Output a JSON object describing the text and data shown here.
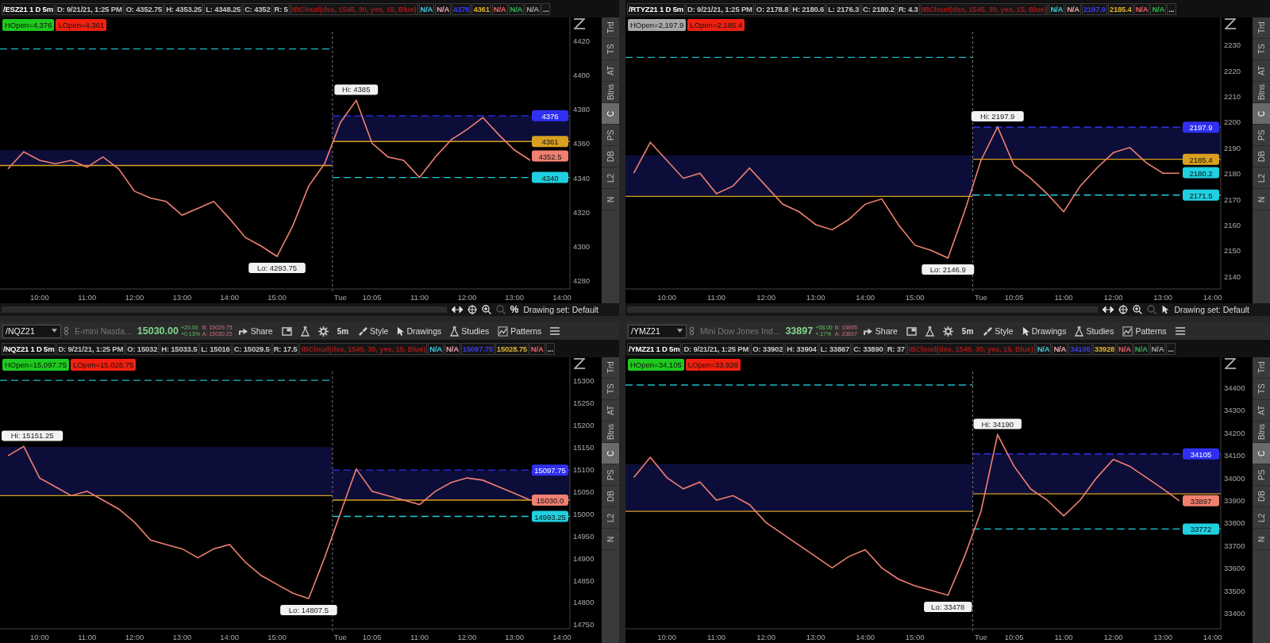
{
  "panels": [
    {
      "header": [
        {
          "text": "/ESZ21 1 D 5m",
          "color": "#ffffff"
        },
        {
          "text": "D: 9/21/21, 1:25 PM",
          "color": "#c8c8c8"
        },
        {
          "text": "O: 4352.75",
          "color": "#c8c8c8"
        },
        {
          "text": "H: 4353.25",
          "color": "#c8c8c8"
        },
        {
          "text": "L: 4348.25",
          "color": "#c8c8c8"
        },
        {
          "text": "C: 4352",
          "color": "#c8c8c8"
        },
        {
          "text": "R: 5",
          "color": "#c8c8c8"
        },
        {
          "text": "IBCloud(dss, 1545, 30, yes, 15, Blue)",
          "color": "#a01818"
        },
        {
          "text": "N/A",
          "color": "#3ec8e0"
        },
        {
          "text": "N/A",
          "color": "#f0a0b0"
        },
        {
          "text": "4376",
          "color": "#3a3af0"
        },
        {
          "text": "4361",
          "color": "#e0b030"
        },
        {
          "text": "N/A",
          "color": "#f06060"
        },
        {
          "text": "N/A",
          "color": "#30b050"
        },
        {
          "text": "N/A",
          "color": "#a0a0a0"
        },
        {
          "text": "..."
        }
      ],
      "badges": [
        {
          "text": "HOpen=4,376",
          "color": "#1ec81e"
        },
        {
          "text": "LOpen=4,361",
          "color": "#f02010"
        }
      ],
      "chart_data": {
        "type": "line",
        "categories": [
          null,
          null,
          "10:00",
          null,
          null,
          "11:00",
          null,
          null,
          "12:00",
          null,
          null,
          "13:00",
          null,
          null,
          "14:00",
          null,
          null,
          "15:00",
          null,
          null,
          null,
          "Tue",
          null,
          "10:05",
          null,
          null,
          "11:00",
          null,
          null,
          "12:00",
          null,
          null,
          "13:00",
          null,
          null,
          "14:00"
        ],
        "series": [
          {
            "color": "#f08070",
            "values": [
              4345,
              4355,
              4350,
              4348,
              4350,
              4346,
              4352,
              4345,
              4332,
              4328,
              4326,
              4318,
              4322,
              4326,
              4316,
              4305,
              4300,
              4294,
              4312,
              4335,
              4348,
              4372,
              4385,
              4360,
              4352,
              4350,
              4340,
              4352,
              4362,
              4368,
              4375,
              4365,
              4356,
              4350,
              null,
              null
            ]
          }
        ],
        "ylim": [
          4275,
          4425
        ],
        "yticks": [
          4280,
          4300,
          4320,
          4340,
          4360,
          4380,
          4400,
          4420
        ],
        "annotations": [
          {
            "y": 4385,
            "text": "Hi: 4385"
          },
          {
            "y": 4294,
            "text": "Lo: 4293.75"
          }
        ]
      },
      "price_tags": [
        {
          "text": "4376",
          "color": "#3030f0"
        },
        {
          "text": "4361",
          "color": "#d8a020"
        },
        {
          "text": "4352.5",
          "color": "#f08070"
        },
        {
          "text": "4340",
          "color": "#20d0e0"
        }
      ],
      "tabs": [
        {
          "label": "Trd",
          "selected": false
        },
        {
          "label": "TS",
          "selected": false
        },
        {
          "label": "AT",
          "selected": false
        },
        {
          "label": "Btns",
          "selected": false
        },
        {
          "label": "C",
          "selected": true
        },
        {
          "label": "PS",
          "selected": false
        },
        {
          "label": "DB",
          "selected": false
        },
        {
          "label": "L2",
          "selected": false
        },
        {
          "label": "N",
          "selected": false
        }
      ],
      "footer": {
        "percent": "%",
        "drawing_set": "Drawing set: Default"
      }
    },
    {
      "header": [
        {
          "text": "/RTYZ21 1 D 5m",
          "color": "#ffffff"
        },
        {
          "text": "D: 9/21/21, 1:25 PM",
          "color": "#c8c8c8"
        },
        {
          "text": "O: 2178.8",
          "color": "#c8c8c8"
        },
        {
          "text": "H: 2180.6",
          "color": "#c8c8c8"
        },
        {
          "text": "L: 2176.3",
          "color": "#c8c8c8"
        },
        {
          "text": "C: 2180.2",
          "color": "#c8c8c8"
        },
        {
          "text": "R: 4.3",
          "color": "#c8c8c8"
        },
        {
          "text": "IBCloud(dss, 1545, 30, yes, 15, Blue)",
          "color": "#a01818"
        },
        {
          "text": "N/A",
          "color": "#3ec8e0"
        },
        {
          "text": "N/A",
          "color": "#f0a0b0"
        },
        {
          "text": "2197.9",
          "color": "#3a3af0"
        },
        {
          "text": "2185.4",
          "color": "#e0b030"
        },
        {
          "text": "N/A",
          "color": "#f06060"
        },
        {
          "text": "N/A",
          "color": "#30b050"
        },
        {
          "text": "..."
        }
      ],
      "badges": [
        {
          "text": "HOpen=2,197.9",
          "color": "#a8a8a8"
        },
        {
          "text": "LOpen=2,185.4",
          "color": "#f02010"
        }
      ],
      "chart_data": {
        "type": "line",
        "categories": [
          null,
          null,
          "10:00",
          null,
          null,
          "11:00",
          null,
          null,
          "12:00",
          null,
          null,
          "13:00",
          null,
          null,
          "14:00",
          null,
          null,
          "15:00",
          null,
          null,
          null,
          "Tue",
          null,
          "10:05",
          null,
          null,
          "11:00",
          null,
          null,
          "12:00",
          null,
          null,
          "13:00",
          null,
          null,
          "14:00"
        ],
        "series": [
          {
            "color": "#f08070",
            "values": [
              2180,
              2192,
              2185,
              2178,
              2180,
              2172,
              2175,
              2182,
              2175,
              2168,
              2165,
              2160,
              2158,
              2162,
              2168,
              2170,
              2160,
              2152,
              2150,
              2147,
              2165,
              2185,
              2198,
              2183,
              2178,
              2172,
              2165,
              2175,
              2182,
              2188,
              2190,
              2184,
              2180,
              2180,
              null,
              null
            ]
          }
        ],
        "ylim": [
          2135,
          2235
        ],
        "yticks": [
          2140,
          2150,
          2160,
          2170,
          2180,
          2190,
          2200,
          2210,
          2220,
          2230
        ],
        "annotations": [
          {
            "y": 2198,
            "text": "Hi: 2197.9"
          },
          {
            "y": 2147,
            "text": "Lo: 2146.9"
          }
        ]
      },
      "price_tags": [
        {
          "text": "2197.9",
          "color": "#3030f0"
        },
        {
          "text": "2185.4",
          "color": "#d8a020"
        },
        {
          "text": "2180.2",
          "color": "#20d0e0"
        },
        {
          "text": "2171.5",
          "color": "#20d0e0"
        }
      ],
      "tabs": [
        {
          "label": "Trd",
          "selected": false
        },
        {
          "label": "TS",
          "selected": false
        },
        {
          "label": "AT",
          "selected": false
        },
        {
          "label": "Btns",
          "selected": false
        },
        {
          "label": "C",
          "selected": true
        },
        {
          "label": "PS",
          "selected": false
        },
        {
          "label": "DB",
          "selected": false
        },
        {
          "label": "L2",
          "selected": false
        },
        {
          "label": "N",
          "selected": false
        }
      ],
      "footer": {
        "drawing_set": "Drawing set: Default"
      }
    },
    {
      "toolbar": {
        "symbol": "/NQZ21",
        "description": "E-mini Nasda...",
        "last": "15030.00",
        "change": [
          "+20.00",
          "+0.13%"
        ],
        "bid": "B: 15029.75",
        "ask": "A: 15030.25",
        "buttons": [
          {
            "kind": "share",
            "label": "Share"
          },
          {
            "kind": "window"
          },
          {
            "kind": "flask"
          },
          {
            "kind": "gear"
          },
          {
            "kind": "text",
            "label": "5m"
          },
          {
            "kind": "style",
            "label": "Style"
          },
          {
            "kind": "cursor",
            "label": "Drawings"
          },
          {
            "kind": "flask",
            "label": "Studies"
          },
          {
            "kind": "patterns",
            "label": "Patterns"
          },
          {
            "kind": "menu"
          }
        ]
      },
      "header": [
        {
          "text": "/NQZ21 1 D 5m",
          "color": "#ffffff"
        },
        {
          "text": "D: 9/21/21, 1:25 PM",
          "color": "#c8c8c8"
        },
        {
          "text": "O: 15032",
          "color": "#c8c8c8"
        },
        {
          "text": "H: 15033.5",
          "color": "#c8c8c8"
        },
        {
          "text": "L: 15016",
          "color": "#c8c8c8"
        },
        {
          "text": "C: 15029.5",
          "color": "#c8c8c8"
        },
        {
          "text": "R: 17.5",
          "color": "#c8c8c8"
        },
        {
          "text": "IBCloud(dss, 1545, 30, yes, 15, Blue)",
          "color": "#a01818"
        },
        {
          "text": "N/A",
          "color": "#3ec8e0"
        },
        {
          "text": "N/A",
          "color": "#f0a0b0"
        },
        {
          "text": "15097.75",
          "color": "#3a3af0"
        },
        {
          "text": "15028.75",
          "color": "#e0b030"
        },
        {
          "text": "N/A",
          "color": "#f06060"
        },
        {
          "text": "..."
        }
      ],
      "badges": [
        {
          "text": "HOpen=15,097.75",
          "color": "#1ec81e"
        },
        {
          "text": "LOpen=15,028.75",
          "color": "#f02010"
        }
      ],
      "chart_data": {
        "type": "line",
        "categories": [
          null,
          null,
          "10:00",
          null,
          null,
          "11:00",
          null,
          null,
          "12:00",
          null,
          null,
          "13:00",
          null,
          null,
          "14:00",
          null,
          null,
          "15:00",
          null,
          null,
          null,
          "Tue",
          null,
          "10:05",
          null,
          null,
          "11:00",
          null,
          null,
          "12:00",
          null,
          null,
          "13:00",
          null,
          null,
          "14:00"
        ],
        "series": [
          {
            "color": "#f08070",
            "values": [
              15130,
              15151,
              15080,
              15060,
              15040,
              15050,
              15030,
              15010,
              14980,
              14940,
              14930,
              14920,
              14900,
              14920,
              14930,
              14890,
              14860,
              14840,
              14820,
              14808,
              14900,
              15000,
              15100,
              15050,
              15040,
              15030,
              15020,
              15050,
              15070,
              15080,
              15075,
              15060,
              15045,
              15030,
              null,
              null
            ]
          }
        ],
        "ylim": [
          14740,
          15320
        ],
        "yticks": [
          14750,
          14800,
          14850,
          14900,
          14950,
          15000,
          15050,
          15100,
          15150,
          15200,
          15250,
          15300
        ],
        "annotations": [
          "Hi: 15151.25",
          {
            "y": 14808,
            "text": "Lo: 14807.5"
          }
        ]
      },
      "price_tags": [
        {
          "text": "15097.75",
          "color": "#3030f0"
        },
        {
          "text": "15030.0",
          "color": "#f08070"
        },
        {
          "text": "14993.25",
          "color": "#20d0e0"
        }
      ],
      "tabs": [
        {
          "label": "Trd",
          "selected": false
        },
        {
          "label": "TS",
          "selected": false
        },
        {
          "label": "AT",
          "selected": false
        },
        {
          "label": "Btns",
          "selected": false
        },
        {
          "label": "C",
          "selected": true
        },
        {
          "label": "PS",
          "selected": false
        },
        {
          "label": "DB",
          "selected": false
        },
        {
          "label": "L2",
          "selected": false
        },
        {
          "label": "N",
          "selected": false
        }
      ]
    },
    {
      "toolbar": {
        "symbol": "/YMZ21",
        "description": "Mini Dow Jones Ind...",
        "last": "33897",
        "change": [
          "+58.00",
          "+.17%"
        ],
        "bid": "B: 33895",
        "ask": "A: 33897",
        "buttons": [
          {
            "kind": "share",
            "label": "Share"
          },
          {
            "kind": "window"
          },
          {
            "kind": "flask"
          },
          {
            "kind": "gear"
          },
          {
            "kind": "text",
            "label": "5m"
          },
          {
            "kind": "style",
            "label": "Style"
          },
          {
            "kind": "cursor",
            "label": "Drawings"
          },
          {
            "kind": "flask",
            "label": "Studies"
          },
          {
            "kind": "patterns",
            "label": "Patterns"
          },
          {
            "kind": "menu"
          }
        ]
      },
      "header": [
        {
          "text": "/YMZ21 1 D 5m",
          "color": "#ffffff"
        },
        {
          "text": "D: 9/21/21, 1:25 PM",
          "color": "#c8c8c8"
        },
        {
          "text": "O: 33902",
          "color": "#c8c8c8"
        },
        {
          "text": "H: 33904",
          "color": "#c8c8c8"
        },
        {
          "text": "L: 33867",
          "color": "#c8c8c8"
        },
        {
          "text": "C: 33890",
          "color": "#c8c8c8"
        },
        {
          "text": "R: 37",
          "color": "#c8c8c8"
        },
        {
          "text": "IBCloud(dss, 1545, 30, yes, 15, Blue)",
          "color": "#a01818"
        },
        {
          "text": "N/A",
          "color": "#3ec8e0"
        },
        {
          "text": "N/A",
          "color": "#f0a0b0"
        },
        {
          "text": "34105",
          "color": "#3a3af0"
        },
        {
          "text": "33928",
          "color": "#e0b030"
        },
        {
          "text": "N/A",
          "color": "#f06060"
        },
        {
          "text": "N/A",
          "color": "#30b050"
        },
        {
          "text": "N/A",
          "color": "#a0a0a0"
        },
        {
          "text": "..."
        }
      ],
      "badges": [
        {
          "text": "HOpen=34,105",
          "color": "#1ec81e"
        },
        {
          "text": "LOpen=33,928",
          "color": "#f02010"
        }
      ],
      "chart_data": {
        "type": "line",
        "categories": [
          null,
          null,
          "10:00",
          null,
          null,
          "11:00",
          null,
          null,
          "12:00",
          null,
          null,
          "13:00",
          null,
          null,
          "14:00",
          null,
          null,
          "15:00",
          null,
          null,
          null,
          "Tue",
          null,
          "10:05",
          null,
          null,
          "11:00",
          null,
          null,
          "12:00",
          null,
          null,
          "13:00",
          null,
          null,
          "14:00"
        ],
        "series": [
          {
            "color": "#f08070",
            "values": [
              34000,
              34090,
              34000,
              33950,
              33980,
              33900,
              33920,
              33880,
              33800,
              33750,
              33700,
              33650,
              33600,
              33650,
              33680,
              33600,
              33550,
              33520,
              33500,
              33478,
              33650,
              33850,
              34190,
              34050,
              33950,
              33900,
              33830,
              33900,
              34000,
              34080,
              34050,
              34000,
              33950,
              33897,
              null,
              null
            ]
          }
        ],
        "ylim": [
          33330,
          34470
        ],
        "yticks": [
          33400,
          33500,
          33600,
          33700,
          33800,
          33900,
          34000,
          34100,
          34200,
          34300,
          34400
        ],
        "annotations": [
          {
            "y": 34190,
            "text": "Hi: 34190"
          },
          {
            "y": 33478,
            "text": "Lo: 33478"
          }
        ]
      },
      "price_tags": [
        {
          "text": "34105",
          "color": "#3030f0"
        },
        {
          "text": "33897",
          "color": "#f08070"
        },
        {
          "text": "33772",
          "color": "#20d0e0"
        }
      ],
      "tabs": [
        {
          "label": "Trd",
          "selected": false
        },
        {
          "label": "TS",
          "selected": false
        },
        {
          "label": "AT",
          "selected": false
        },
        {
          "label": "Btns",
          "selected": false
        },
        {
          "label": "C",
          "selected": true
        },
        {
          "label": "PS",
          "selected": false
        },
        {
          "label": "DB",
          "selected": false
        },
        {
          "label": "L2",
          "selected": false
        },
        {
          "label": "N",
          "selected": false
        }
      ]
    }
  ]
}
